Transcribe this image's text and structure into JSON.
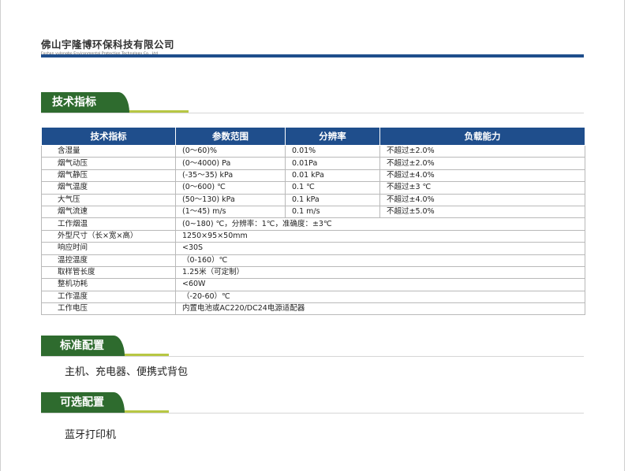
{
  "company": {
    "name_cn": "佛山宇隆博环保科技有限公司",
    "name_en": "Foshan yulongbo Environmental Protection Technology Co., Ltd"
  },
  "sections": {
    "tech": "技术指标",
    "standard": "标准配置",
    "optional": "可选配置"
  },
  "table": {
    "headers": [
      "技术指标",
      "参数范围",
      "分辨率",
      "负载能力"
    ],
    "rows": [
      {
        "name": "含湿量",
        "range": "(0～60)%",
        "resolution": "0.01%",
        "load": "不超过±2.0%"
      },
      {
        "name": "烟气动压",
        "range": "(0～4000) Pa",
        "resolution": "0.01Pa",
        "load": "不超过±2.0%"
      },
      {
        "name": "烟气静压",
        "range": "(-35～35) kPa",
        "resolution": "0.01 kPa",
        "load": "不超过±4.0%"
      },
      {
        "name": "烟气温度",
        "range": "(0～600) ℃",
        "resolution": "0.1 ℃",
        "load": "不超过±3 ℃"
      },
      {
        "name": "大气压",
        "range": "(50～130) kPa",
        "resolution": "0.1 kPa",
        "load": "不超过±4.0%"
      },
      {
        "name": "烟气流速",
        "range": "(1～45) m/s",
        "resolution": "0.1 m/s",
        "load": "不超过±5.0%"
      }
    ],
    "merged_rows": [
      {
        "name": "工作烟温",
        "value": "(0~180) ℃，分辨率：1℃，准确度：±3℃"
      },
      {
        "name": "外型尺寸（长×宽×高）",
        "value": "1250×95×50mm"
      },
      {
        "name": "响应时间",
        "value": "<30S"
      },
      {
        "name": "温控温度",
        "value": "（0-160）℃"
      },
      {
        "name": "取样管长度",
        "value": "1.25米（可定制）"
      },
      {
        "name": "整机功耗",
        "value": "<60W"
      },
      {
        "name": "工作温度",
        "value": "（-20-60）℃"
      },
      {
        "name": "工作电压",
        "value": "内置电池或AC220/DC24电源适配器"
      }
    ]
  },
  "standard_config": "主机、充电器、便携式背包",
  "optional_config": "蓝牙打印机"
}
